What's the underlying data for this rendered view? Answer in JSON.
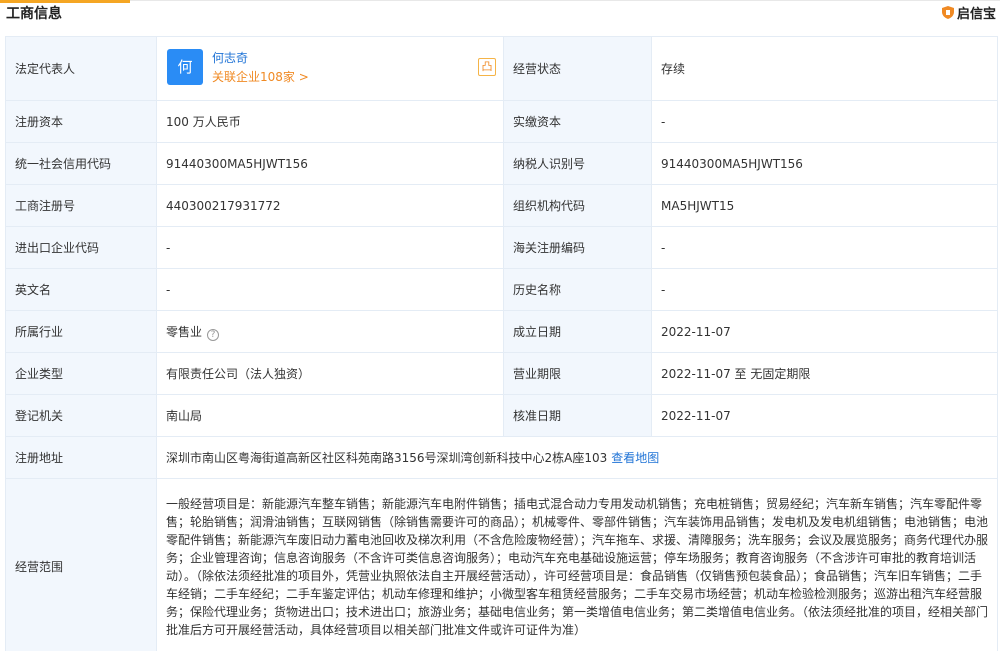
{
  "header": {
    "title": "工商信息",
    "brand": "启信宝"
  },
  "rows": {
    "legal_rep_label": "法定代表人",
    "legal_rep_avatar": "何",
    "legal_rep_name": "何志奇",
    "legal_rep_link": "关联企业108家 >",
    "legal_rep_btn": "凸",
    "status_label": "经营状态",
    "status_value": "存续",
    "reg_capital_label": "注册资本",
    "reg_capital_value": "100 万人民币",
    "paid_capital_label": "实缴资本",
    "paid_capital_value": "-",
    "credit_code_label": "统一社会信用代码",
    "credit_code_value": "91440300MA5HJWT156",
    "tax_id_label": "纳税人识别号",
    "tax_id_value": "91440300MA5HJWT156",
    "reg_no_label": "工商注册号",
    "reg_no_value": "440300217931772",
    "org_code_label": "组织机构代码",
    "org_code_value": "MA5HJWT15",
    "import_export_label": "进出口企业代码",
    "import_export_value": "-",
    "customs_label": "海关注册编码",
    "customs_value": "-",
    "english_name_label": "英文名",
    "english_name_value": "-",
    "history_name_label": "历史名称",
    "history_name_value": "-",
    "industry_label": "所属行业",
    "industry_value": "零售业",
    "founded_label": "成立日期",
    "founded_value": "2022-11-07",
    "company_type_label": "企业类型",
    "company_type_value": "有限责任公司（法人独资）",
    "business_term_label": "营业期限",
    "business_term_value": "2022-11-07 至 无固定期限",
    "authority_label": "登记机关",
    "authority_value": "南山局",
    "approval_date_label": "核准日期",
    "approval_date_value": "2022-11-07",
    "address_label": "注册地址",
    "address_value": "深圳市南山区粤海街道高新区社区科苑南路3156号深圳湾创新科技中心2栋A座103",
    "address_map_link": "查看地图",
    "scope_label": "经营范围",
    "scope_value": "一般经营项目是：新能源汽车整车销售；新能源汽车电附件销售；插电式混合动力专用发动机销售；充电桩销售；贸易经纪；汽车新车销售；汽车零配件零售；轮胎销售；润滑油销售；互联网销售（除销售需要许可的商品）；机械零件、零部件销售；汽车装饰用品销售；发电机及发电机组销售；电池销售；电池零配件销售；新能源汽车废旧动力蓄电池回收及梯次利用（不含危险废物经营）；汽车拖车、求援、清障服务；洗车服务；会议及展览服务；商务代理代办服务；企业管理咨询；信息咨询服务（不含许可类信息咨询服务）；电动汽车充电基础设施运营；停车场服务；教育咨询服务（不含涉许可审批的教育培训活动）。（除依法须经批准的项目外，凭营业执照依法自主开展经营活动），许可经营项目是：食品销售（仅销售预包装食品）；食品销售；汽车旧车销售；二手车经销；二手车经纪；二手车鉴定评估；机动车修理和维护；小微型客车租赁经营服务；二手车交易市场经营；机动车检验检测服务；巡游出租汽车经营服务；保险代理业务；货物进出口；技术进出口；旅游业务；基础电信业务；第一类增值电信业务；第二类增值电信业务。（依法须经批准的项目，经相关部门批准后方可开展经营活动，具体经营项目以相关部门批准文件或许可证件为准）"
  },
  "icons": {
    "help": "?",
    "brand_shield_color": "#f08a24"
  }
}
